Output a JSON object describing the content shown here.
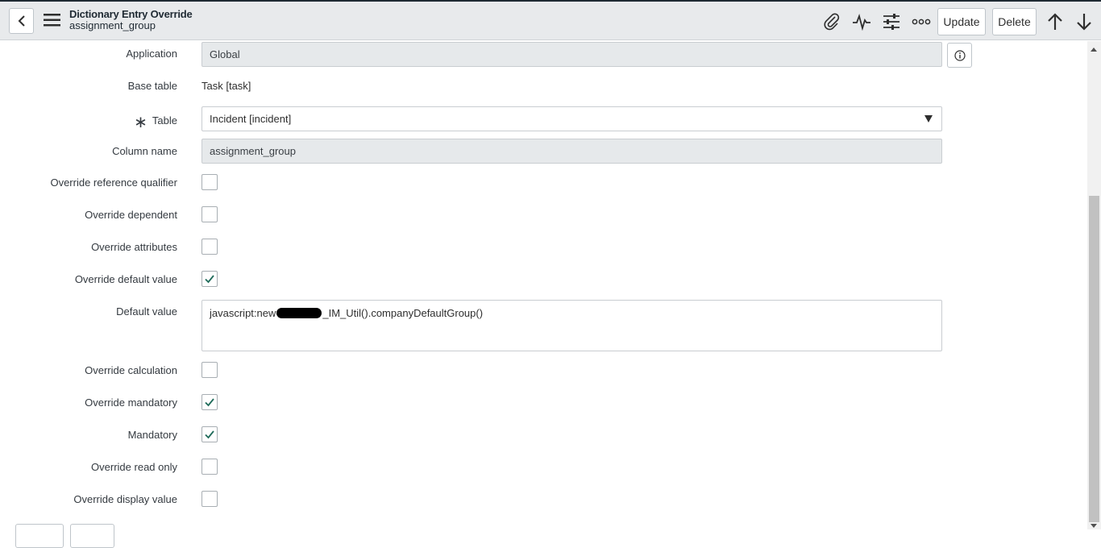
{
  "header": {
    "title": "Dictionary Entry Override",
    "subtitle": "assignment_group",
    "update_label": "Update",
    "delete_label": "Delete",
    "icons": [
      "back-icon",
      "menu-icon",
      "paperclip-icon",
      "activity-icon",
      "settings-sliders-icon",
      "more-icon",
      "arrow-up-icon",
      "arrow-down-icon"
    ]
  },
  "form": {
    "application": {
      "label": "Application",
      "value": "Global"
    },
    "base_table": {
      "label": "Base table",
      "value": "Task [task]"
    },
    "table": {
      "label": "Table",
      "value": "Incident [incident]",
      "required_mark": "∗"
    },
    "column_name": {
      "label": "Column name",
      "value": "assignment_group"
    },
    "override_reference_qualifier": {
      "label": "Override reference qualifier",
      "checked": false
    },
    "override_dependent": {
      "label": "Override dependent",
      "checked": false
    },
    "override_attributes": {
      "label": "Override attributes",
      "checked": false
    },
    "override_default_value": {
      "label": "Override default value",
      "checked": true
    },
    "default_value": {
      "label": "Default value",
      "value_prefix": "javascript:new",
      "value_suffix": "_IM_Util().companyDefaultGroup()"
    },
    "override_calculation": {
      "label": "Override calculation",
      "checked": false
    },
    "override_mandatory": {
      "label": "Override mandatory",
      "checked": true
    },
    "mandatory": {
      "label": "Mandatory",
      "checked": true
    },
    "override_read_only": {
      "label": "Override read only",
      "checked": false
    },
    "override_display_value": {
      "label": "Override display value",
      "checked": false
    }
  },
  "colors": {
    "header_bg": "#e8eaec",
    "checkmark": "#278efc",
    "readonly_bg": "#e6e9eb"
  }
}
